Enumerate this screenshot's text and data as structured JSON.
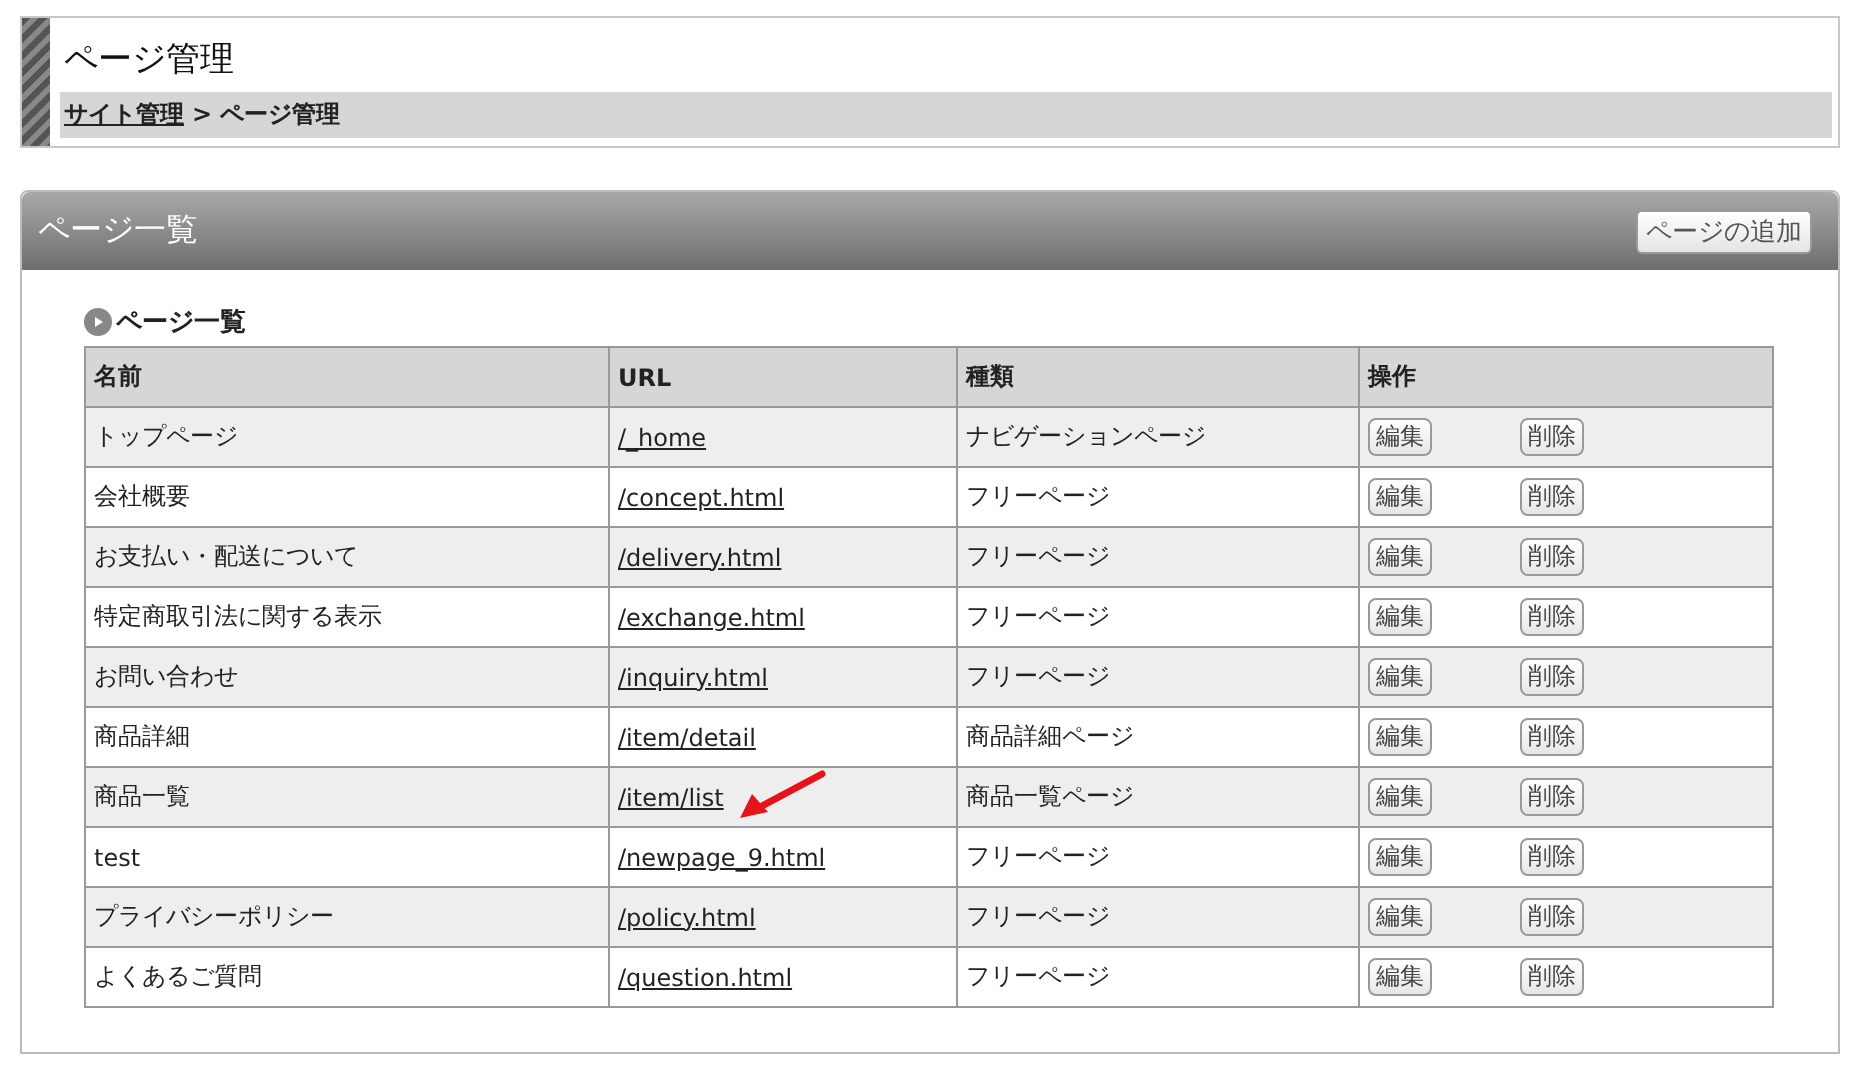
{
  "header": {
    "title": "ページ管理",
    "breadcrumb": [
      {
        "label": "サイト管理",
        "link": true
      },
      {
        "label": "> ページ管理",
        "link": false
      }
    ]
  },
  "panel": {
    "title": "ページ一覧",
    "add_button": "ページの追加",
    "section_title": "ページ一覧",
    "table": {
      "columns": [
        "名前",
        "URL",
        "種類",
        "操作"
      ],
      "rows": [
        {
          "name": "トップページ",
          "url": "/_home",
          "type": "ナビゲーションページ",
          "actions": [
            "編集",
            "削除"
          ]
        },
        {
          "name": "会社概要",
          "url": "/concept.html",
          "type": "フリーページ",
          "actions": [
            "編集",
            "削除"
          ]
        },
        {
          "name": "お支払い・配送について",
          "url": "/delivery.html",
          "type": "フリーページ",
          "actions": [
            "編集",
            "削除"
          ]
        },
        {
          "name": "特定商取引法に関する表示",
          "url": "/exchange.html",
          "type": "フリーページ",
          "actions": [
            "編集",
            "削除"
          ]
        },
        {
          "name": "お問い合わせ",
          "url": "/inquiry.html",
          "type": "フリーページ",
          "actions": [
            "編集",
            "削除"
          ]
        },
        {
          "name": "商品詳細",
          "url": "/item/detail",
          "type": "商品詳細ページ",
          "actions": [
            "編集",
            "削除"
          ]
        },
        {
          "name": "商品一覧",
          "url": "/item/list",
          "type": "商品一覧ページ",
          "actions": [
            "編集",
            "削除"
          ],
          "annotated": true
        },
        {
          "name": "test",
          "url": "/newpage_9.html",
          "type": "フリーページ",
          "actions": [
            "編集",
            "削除"
          ]
        },
        {
          "name": "プライバシーポリシー",
          "url": "/policy.html",
          "type": "フリーページ",
          "actions": [
            "編集",
            "削除"
          ]
        },
        {
          "name": "よくあるご質問",
          "url": "/question.html",
          "type": "フリーページ",
          "actions": [
            "編集",
            "削除"
          ]
        }
      ]
    }
  }
}
